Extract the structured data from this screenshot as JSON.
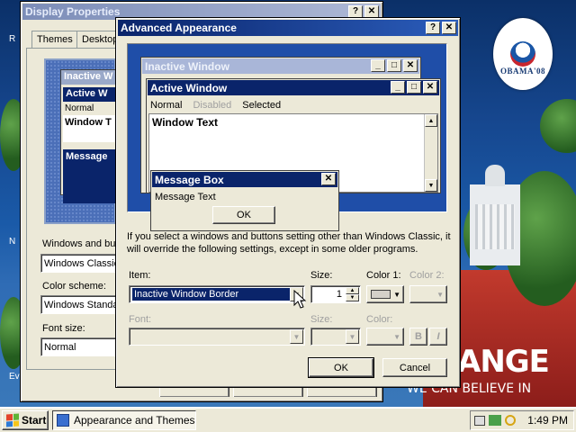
{
  "colors": {
    "active_title_start": "#0a246a",
    "active_title_end": "#2b5dbb",
    "face": "#ece9d8",
    "preview_bg": "#1f4ea8",
    "selected_item": "#0a246a"
  },
  "desktop": {
    "logo_text": "OBAMA'08",
    "banner_change": "ANGE",
    "banner_slogan": "WE CAN BELIEVE IN",
    "edge_icons": [
      "R",
      "N",
      "Ev"
    ]
  },
  "display_properties": {
    "title": "Display Properties",
    "tabs": [
      "Themes",
      "Desktop"
    ],
    "preview_inactive": "Inactive W",
    "preview_active": "Active W",
    "preview_normal": "Normal",
    "preview_window_text": "Window T",
    "preview_message": "Message",
    "windows_buttons_label": "Windows and but",
    "windows_buttons_value": "Windows Classic",
    "color_scheme_label": "Color scheme:",
    "color_scheme_value": "Windows Standa",
    "font_size_label": "Font size:",
    "font_size_value": "Normal"
  },
  "advanced": {
    "title": "Advanced Appearance",
    "help_glyph": "?",
    "close_glyph": "✕",
    "preview": {
      "inactive_title": "Inactive Window",
      "active_title": "Active Window",
      "menu_normal": "Normal",
      "menu_disabled": "Disabled",
      "menu_selected": "Selected",
      "window_text": "Window Text",
      "message_box_title": "Message Box",
      "message_text": "Message Text",
      "ok": "OK"
    },
    "info": "If you select a windows and buttons setting other than Windows Classic, it will override the following settings, except in some older programs.",
    "item_label": "Item:",
    "item_value": "Inactive Window Border",
    "size_label": "Size:",
    "size_value": "1",
    "color1_label": "Color 1:",
    "color2_label": "Color 2:",
    "font_label": "Font:",
    "font_size_label": "Size:",
    "font_color_label": "Color:",
    "bold_glyph": "B",
    "italic_glyph": "I",
    "ok_label": "OK",
    "cancel_label": "Cancel"
  },
  "taskbar": {
    "start_label": "Start",
    "task_label": "Appearance and Themes",
    "clock": "1:49 PM"
  }
}
